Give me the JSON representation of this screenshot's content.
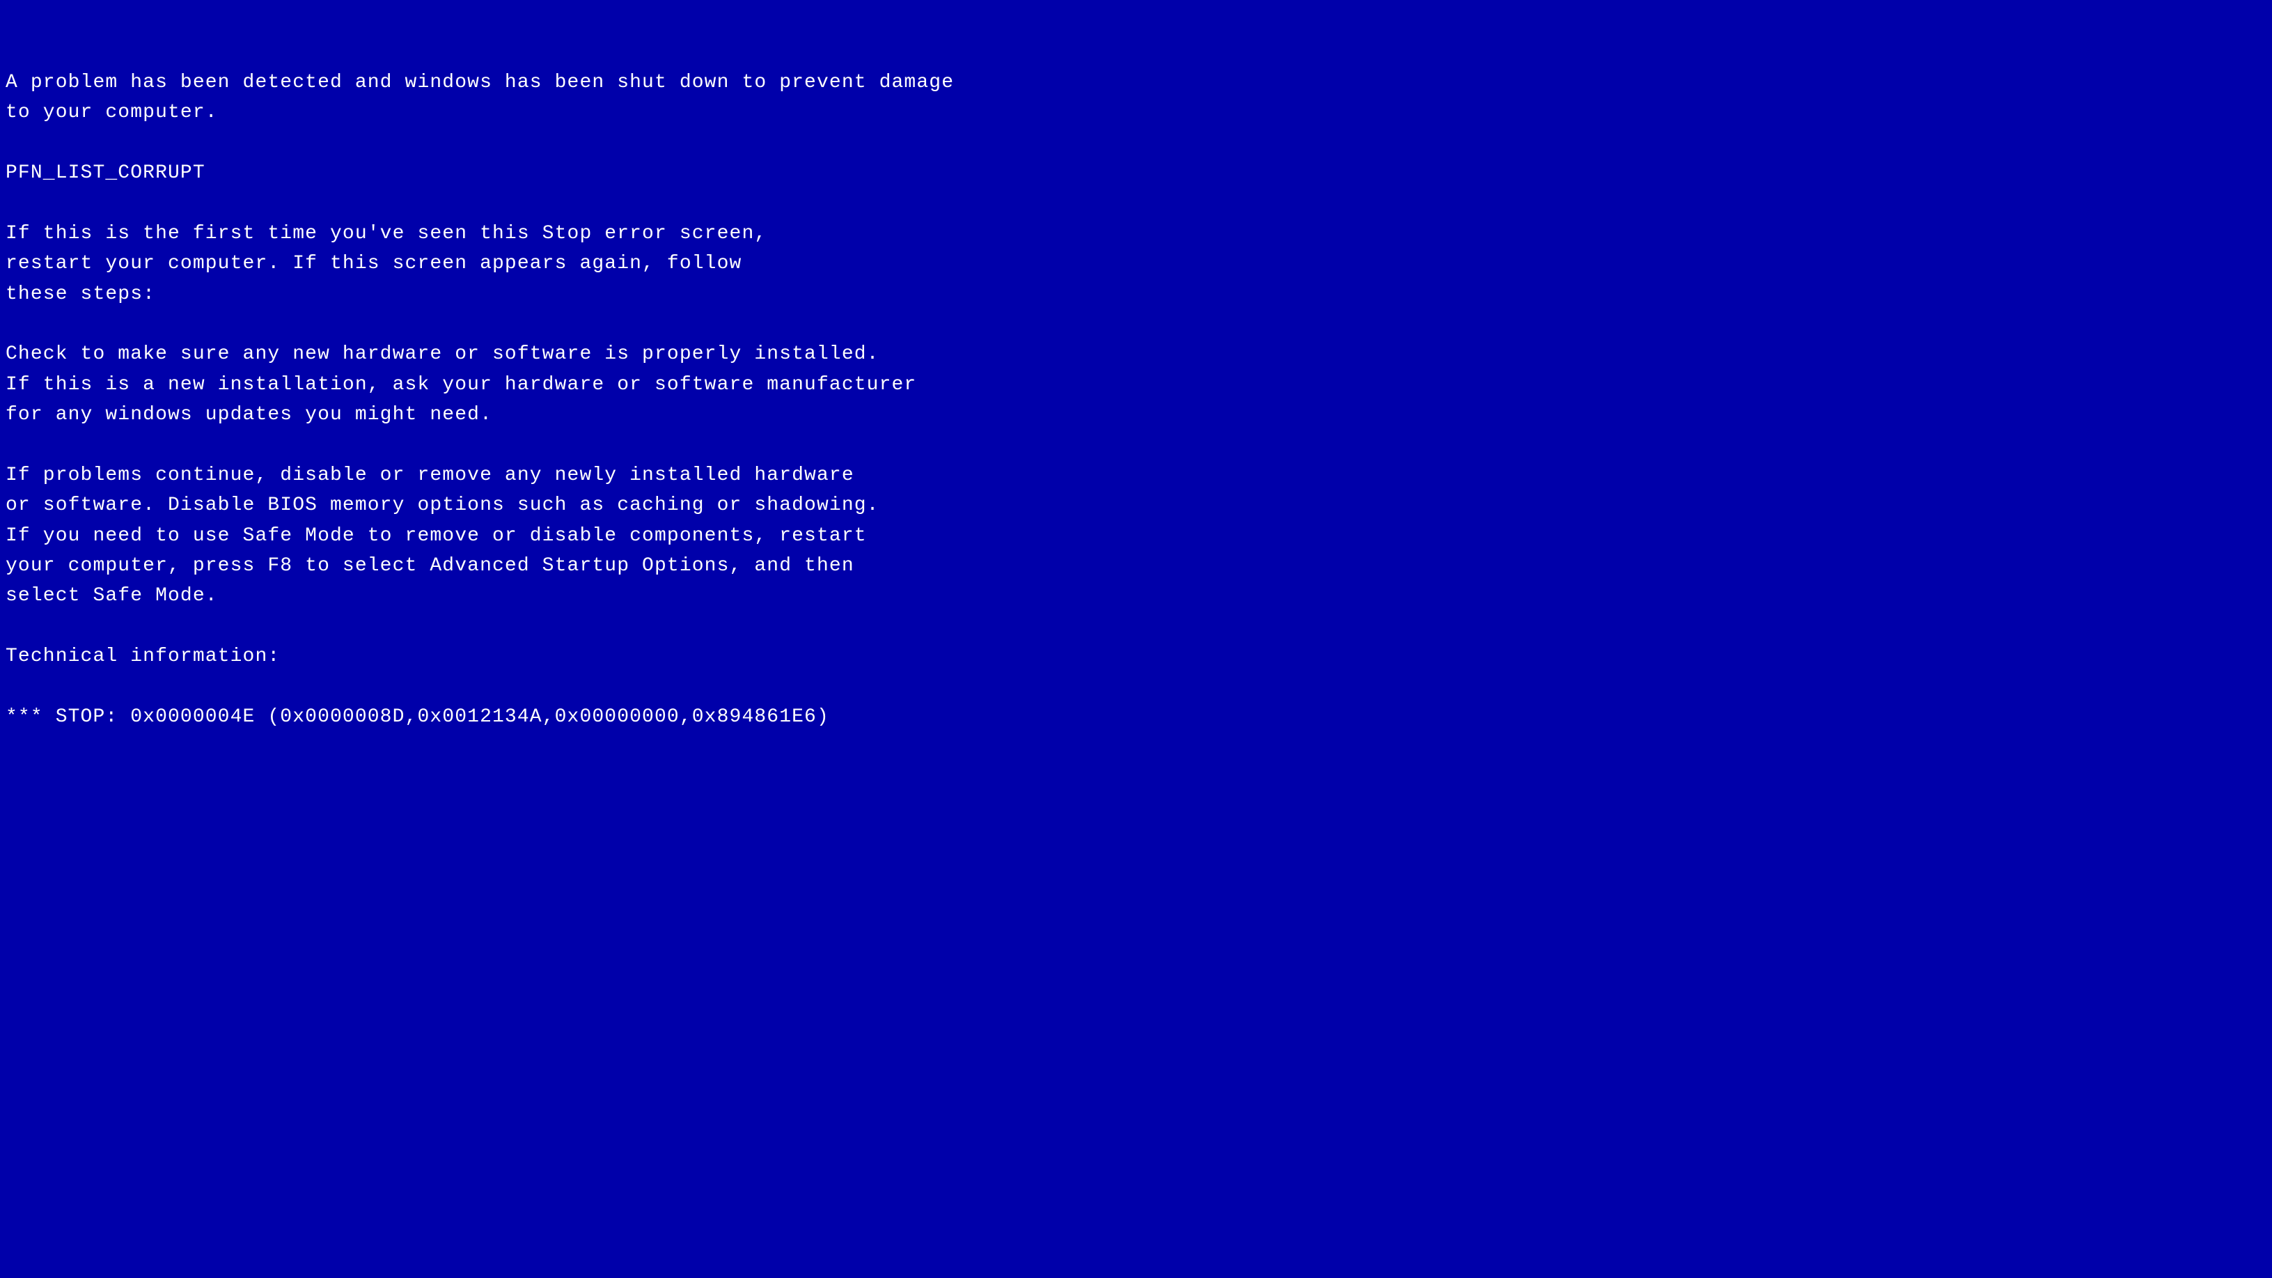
{
  "bsod": {
    "lines": [
      {
        "id": "line1",
        "text": "A problem has been detected and windows has been shut down to prevent damage"
      },
      {
        "id": "line2",
        "text": "to your computer."
      },
      {
        "id": "blank1",
        "text": ""
      },
      {
        "id": "error_code",
        "text": "PFN_LIST_CORRUPT"
      },
      {
        "id": "blank2",
        "text": ""
      },
      {
        "id": "line3",
        "text": "If this is the first time you've seen this Stop error screen,"
      },
      {
        "id": "line4",
        "text": "restart your computer. If this screen appears again, follow"
      },
      {
        "id": "line5",
        "text": "these steps:"
      },
      {
        "id": "blank3",
        "text": ""
      },
      {
        "id": "line6",
        "text": "Check to make sure any new hardware or software is properly installed."
      },
      {
        "id": "line7",
        "text": "If this is a new installation, ask your hardware or software manufacturer"
      },
      {
        "id": "line8",
        "text": "for any windows updates you might need."
      },
      {
        "id": "blank4",
        "text": ""
      },
      {
        "id": "line9",
        "text": "If problems continue, disable or remove any newly installed hardware"
      },
      {
        "id": "line10",
        "text": "or software. Disable BIOS memory options such as caching or shadowing."
      },
      {
        "id": "line11",
        "text": "If you need to use Safe Mode to remove or disable components, restart"
      },
      {
        "id": "line12",
        "text": "your computer, press F8 to select Advanced Startup Options, and then"
      },
      {
        "id": "line13",
        "text": "select Safe Mode."
      },
      {
        "id": "blank5",
        "text": ""
      },
      {
        "id": "tech_header",
        "text": "Technical information:"
      },
      {
        "id": "blank6",
        "text": ""
      },
      {
        "id": "stop_code",
        "text": "*** STOP: 0x0000004E (0x0000008D,0x0012134A,0x00000000,0x894861E6)"
      }
    ]
  }
}
